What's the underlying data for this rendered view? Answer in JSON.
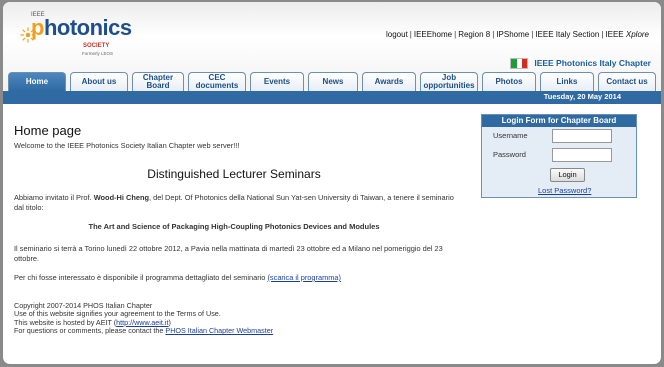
{
  "header": {
    "logo": {
      "ieee": "IEEE",
      "word_p": "p",
      "word_rest": "hotonics",
      "society": "SOCIETY",
      "formerly": "Formerly LEOS"
    },
    "toplinks": [
      "logout",
      "IEEEhome",
      "Region 8",
      "IPShome",
      "IEEE Italy Section",
      "IEEE"
    ],
    "toplinks_last": "Xplore",
    "chapter_title": "IEEE Photonics Italy Chapter",
    "flag_colors": [
      "#1f9c3a",
      "#ffffff",
      "#d52b1e"
    ]
  },
  "nav": {
    "tabs": [
      {
        "label": "Home"
      },
      {
        "label": "About us"
      },
      {
        "label": "Chapter Board"
      },
      {
        "label": "CEC documents"
      },
      {
        "label": "Events"
      },
      {
        "label": "News"
      },
      {
        "label": "Awards"
      },
      {
        "label": "Job opportunities"
      },
      {
        "label": "Photos"
      },
      {
        "label": "Links"
      },
      {
        "label": "Contact us"
      }
    ],
    "date": "Tuesday, 20 May 2014"
  },
  "main": {
    "title": "Home page",
    "welcome": "Welcome to the IEEE Photonics Society Italian Chapter web server!!!",
    "section_title": "Distinguished Lecturer Seminars",
    "intro_pre": "Abbiamo invitato il Prof. ",
    "intro_name": "Wood-Hi Cheng",
    "intro_post": ", del Dept. Of Photonics della National Sun Yat-sen University di Taiwan, a tenere il seminario dal titolo:",
    "talk_title": "The Art and Science of Packaging High-Coupling Photonics Devices and Modules",
    "schedule": "Il seminario si terrà a Torino lunedì 22 ottobre 2012, a Pavia nella mattinata di martedì 23 ottobre ed a Milano nel pomeriggio del 23 ottobre.",
    "program_pre": "Per chi fosse interessato è disponibile il programma dettagliato del seminario ",
    "program_link": "(scarica il programma)",
    "footer": {
      "copyright": "Copyright 2007-2014 PHOS Italian Chapter",
      "terms": "Use of this website signifies your agreement to the Terms of Use.",
      "hosted_pre": "This website is hosted by AEIT (",
      "hosted_link": "http://www.aeit.it",
      "hosted_post": ")",
      "contact_pre": "For questions or comments, please contact the ",
      "contact_link": "PHOS Italian Chapter Webmaster"
    }
  },
  "login": {
    "header": "Login Form for Chapter Board",
    "username_label": "Username",
    "password_label": "Password",
    "username_value": "",
    "password_value": "",
    "button": "Login",
    "lost_password": "Lost Password?"
  },
  "colors": {
    "accent": "#2f6aa3",
    "link": "#1a3fa0",
    "page_bg": "#8a8a8a"
  }
}
